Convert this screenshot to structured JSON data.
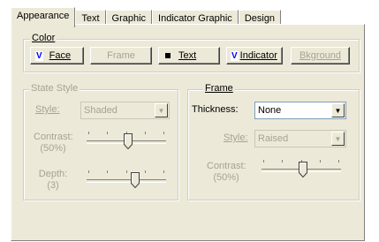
{
  "tabs": [
    {
      "label": "Appearance",
      "active": true
    },
    {
      "label": "Text",
      "active": false
    },
    {
      "label": "Graphic",
      "active": false
    },
    {
      "label": "Indicator Graphic",
      "active": false
    },
    {
      "label": "Design",
      "active": false
    }
  ],
  "color_group": {
    "legend": "Color",
    "buttons": {
      "face": {
        "label": "Face",
        "swatch_char": "V",
        "swatch_color": "#0000ff",
        "enabled": true
      },
      "frame": {
        "label": "Frame",
        "enabled": false
      },
      "text": {
        "label": "Text",
        "swatch_color": "#000000",
        "enabled": true
      },
      "indicator": {
        "label": "Indicator",
        "swatch_char": "V",
        "swatch_color": "#0000ff",
        "enabled": true
      },
      "bkground": {
        "label": "Bkground",
        "enabled": false
      }
    }
  },
  "state_style": {
    "legend": "State Style",
    "style_label": "Style:",
    "style_value": "Shaded",
    "contrast_label": "Contrast:",
    "contrast_value": "(50%)",
    "contrast_level": 0.5,
    "depth_label": "Depth:",
    "depth_value": "(3)",
    "depth_level": 0.6
  },
  "frame_group": {
    "legend": "Frame",
    "thickness_label": "Thickness:",
    "thickness_value": "None",
    "style_label": "Style:",
    "style_value": "Raised",
    "contrast_label": "Contrast:",
    "contrast_value": "(50%)",
    "contrast_level": 0.5
  }
}
